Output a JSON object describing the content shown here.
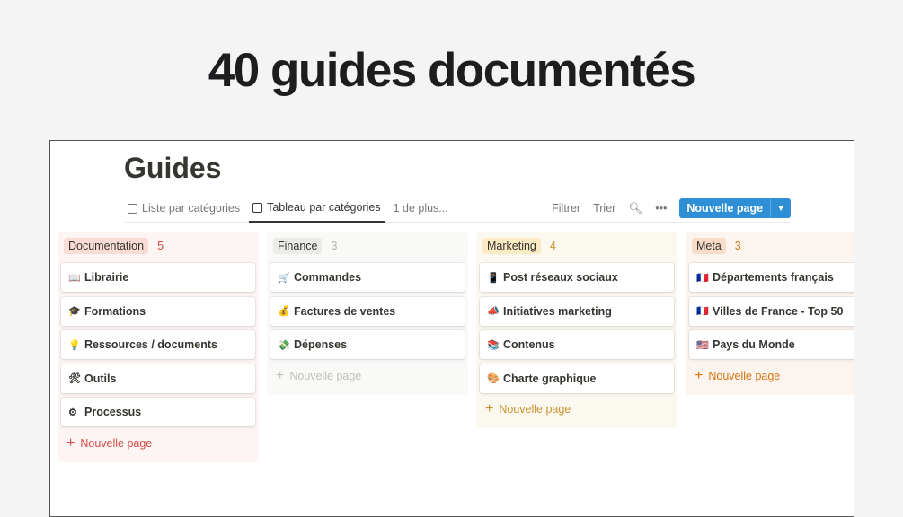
{
  "headline": "40 guides documentés",
  "page_title": "Guides",
  "tabs": [
    {
      "label": "Liste par catégories"
    },
    {
      "label": "Tableau par catégories"
    },
    {
      "label": "1 de plus..."
    }
  ],
  "toolbar": {
    "filter": "Filtrer",
    "sort": "Trier",
    "new_page": "Nouvelle page"
  },
  "columns": [
    {
      "name": "Documentation",
      "count": "5",
      "new": "Nouvelle page",
      "cards": [
        {
          "emoji": "📖",
          "title": "Librairie"
        },
        {
          "emoji": "🎓",
          "title": "Formations"
        },
        {
          "emoji": "💡",
          "title": "Ressources / documents"
        },
        {
          "emoji": "🛠",
          "title": "Outils"
        },
        {
          "emoji": "⚙",
          "title": "Processus"
        }
      ]
    },
    {
      "name": "Finance",
      "count": "3",
      "new": "Nouvelle page",
      "cards": [
        {
          "emoji": "🛒",
          "title": "Commandes"
        },
        {
          "emoji": "💰",
          "title": "Factures de ventes"
        },
        {
          "emoji": "💸",
          "title": "Dépenses"
        }
      ]
    },
    {
      "name": "Marketing",
      "count": "4",
      "new": "Nouvelle page",
      "cards": [
        {
          "emoji": "📱",
          "title": "Post réseaux sociaux"
        },
        {
          "emoji": "📣",
          "title": "Initiatives marketing"
        },
        {
          "emoji": "📚",
          "title": "Contenus"
        },
        {
          "emoji": "🎨",
          "title": "Charte graphique"
        }
      ]
    },
    {
      "name": "Meta",
      "count": "3",
      "new": "Nouvelle page",
      "cards": [
        {
          "emoji": "🇫🇷",
          "title": "Départements français"
        },
        {
          "emoji": "🇫🇷",
          "title": "Villes de France - Top 50"
        },
        {
          "emoji": "🇺🇸",
          "title": "Pays du Monde"
        }
      ]
    }
  ],
  "colors": {
    "accent": "#2e8fd6"
  }
}
